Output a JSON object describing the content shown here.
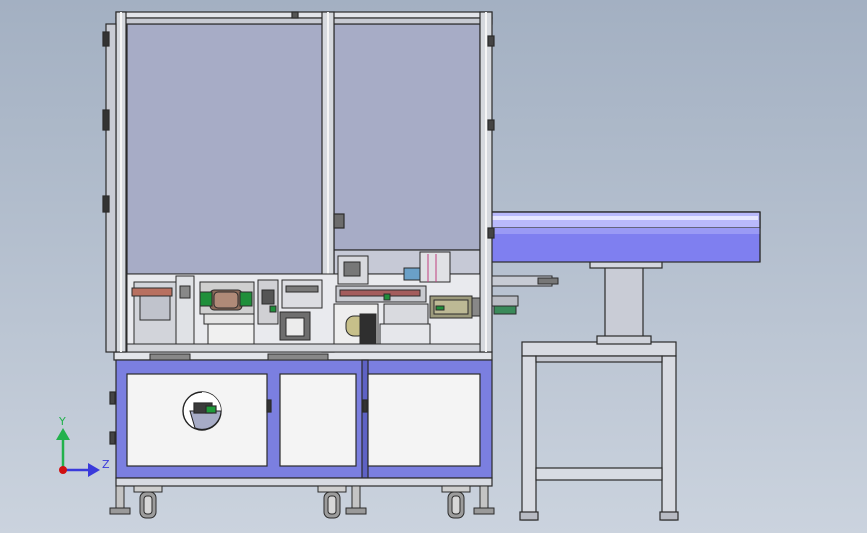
{
  "viewport": {
    "background_top": "#a3b0c2",
    "background_bottom": "#cbd3de"
  },
  "machine": {
    "frame_color": "#d6d9de",
    "frame_edge": "#2b2b2b",
    "glass_color": "#a7acc6",
    "base_panel_color": "#7b7fe0",
    "door_color": "#f4f4f4",
    "conveyor_color": "#7f7ff0",
    "conveyor_highlight": "#d3d3ff"
  },
  "axis_triad": {
    "y_label": "Y",
    "z_label": "Z",
    "y_color": "#22b14c",
    "z_color": "#3a3adb",
    "origin_color": "#d01010"
  }
}
